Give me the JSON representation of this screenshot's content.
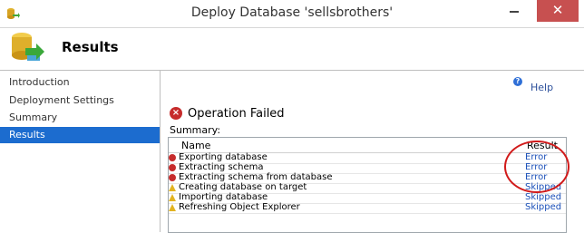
{
  "window": {
    "title": "Deploy Database 'sellsbrothers'",
    "close_glyph": "✕"
  },
  "header": {
    "title": "Results"
  },
  "sidebar": {
    "items": [
      {
        "label": "Introduction",
        "active": false
      },
      {
        "label": "Deployment Settings",
        "active": false
      },
      {
        "label": "Summary",
        "active": false
      },
      {
        "label": "Results",
        "active": true
      }
    ]
  },
  "main": {
    "help_label": "Help",
    "operation_title": "Operation Failed",
    "summary_label": "Summary:",
    "table": {
      "columns": [
        "Name",
        "Result"
      ],
      "rows": [
        {
          "name": "Exporting database",
          "result": "Error",
          "status": "error"
        },
        {
          "name": "Extracting schema",
          "result": "Error",
          "status": "error"
        },
        {
          "name": "Extracting schema from database",
          "result": "Error",
          "status": "error"
        },
        {
          "name": "Creating database on target",
          "result": "Skipped",
          "status": "warning"
        },
        {
          "name": "Importing database",
          "result": "Skipped",
          "status": "warning"
        },
        {
          "name": "Refreshing Object Explorer",
          "result": "Skipped",
          "status": "warning"
        }
      ]
    }
  },
  "icons": {
    "app": "database-deploy-icon",
    "header": "database-deploy-icon",
    "help": "help-icon",
    "operation": "error-icon",
    "error_row": "error-icon",
    "warning_row": "warning-icon"
  },
  "colors": {
    "close_button": "#c75050",
    "selected_nav": "#1c6ccf",
    "link": "#1a4fb8",
    "error": "#c62b2b",
    "warning": "#e2b320",
    "annotation": "#d11a1a"
  }
}
